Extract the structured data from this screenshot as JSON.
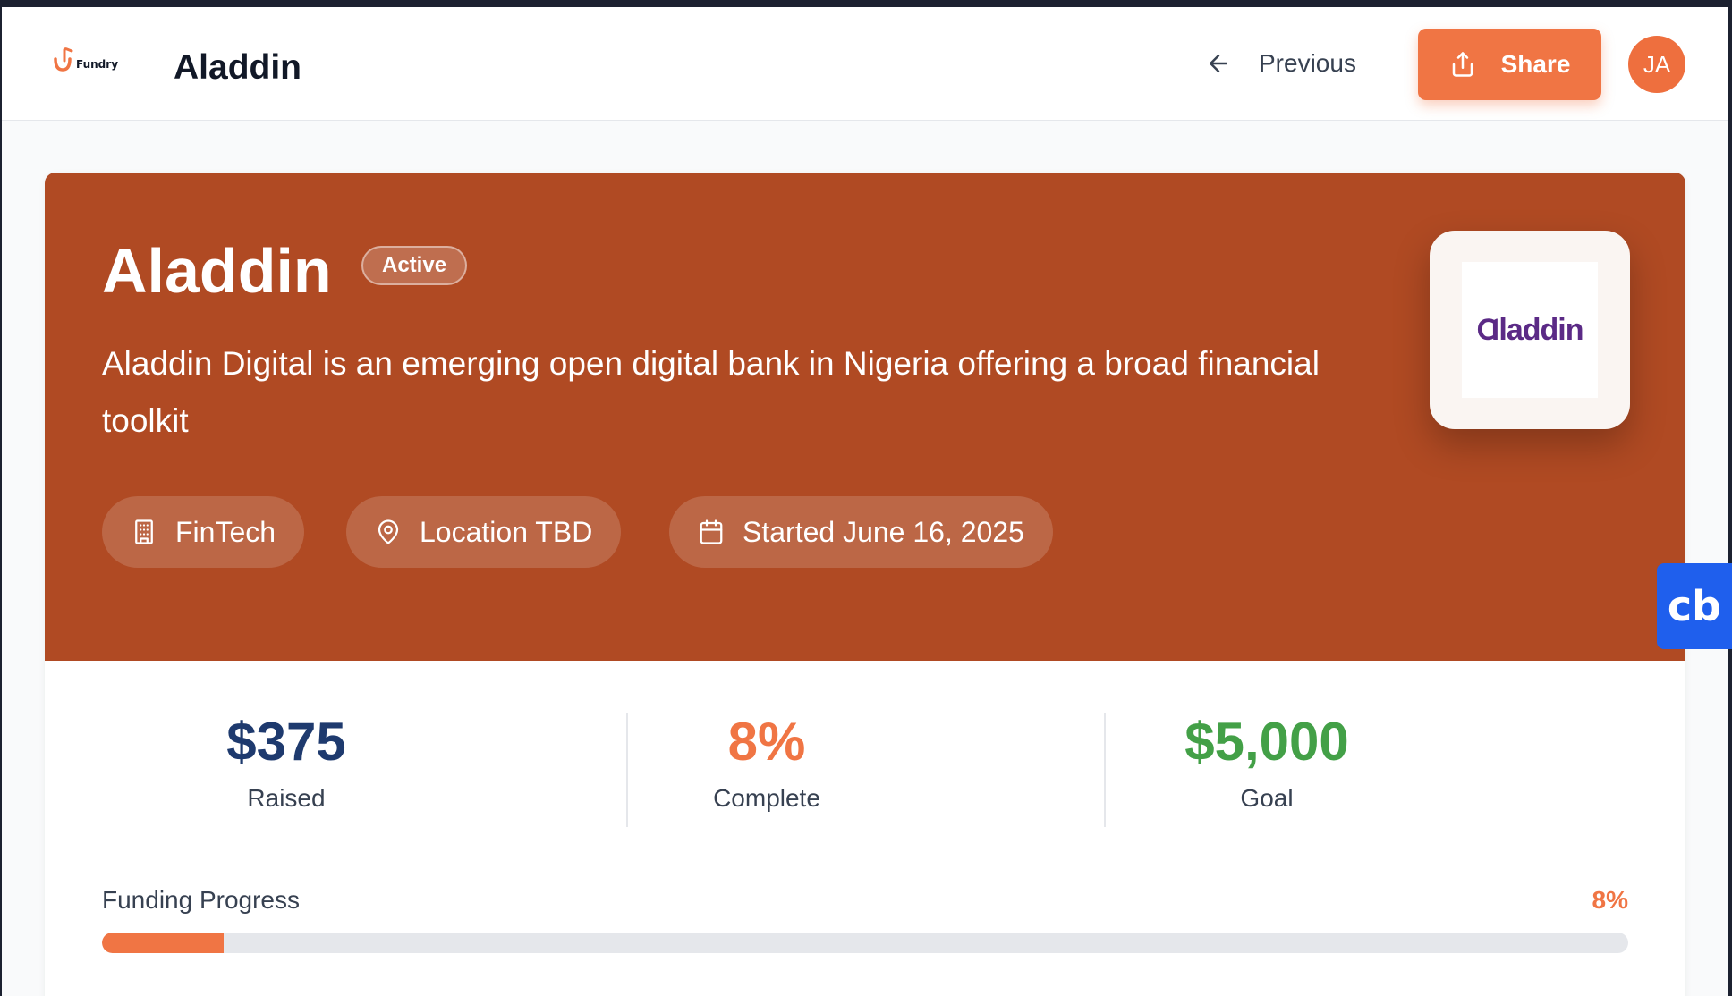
{
  "header": {
    "logo_text": "Fundry",
    "title": "Aladdin",
    "previous_label": "Previous",
    "share_label": "Share",
    "avatar_initials": "JA"
  },
  "hero": {
    "title": "Aladdin",
    "status_badge": "Active",
    "description": "Aladdin Digital is an emerging open digital bank in Nigeria offering a broad financial toolkit",
    "chips": [
      {
        "icon": "building-icon",
        "label": "FinTech"
      },
      {
        "icon": "map-pin-icon",
        "label": "Location TBD"
      },
      {
        "icon": "calendar-icon",
        "label": "Started June 16, 2025"
      }
    ],
    "company_logo_text": "Ɑladdin",
    "background_color": "#b04a23"
  },
  "stats": {
    "raised": {
      "value": "$375",
      "label": "Raised"
    },
    "complete": {
      "value": "8%",
      "label": "Complete"
    },
    "goal": {
      "value": "$5,000",
      "label": "Goal"
    }
  },
  "funding_progress": {
    "label": "Funding Progress",
    "percent_text": "8%",
    "fraction": 0.08
  },
  "floating_widget": {
    "label": "cb"
  },
  "colors": {
    "accent": "#f07544",
    "raised": "#1e3a6e",
    "goal": "#43a047"
  }
}
